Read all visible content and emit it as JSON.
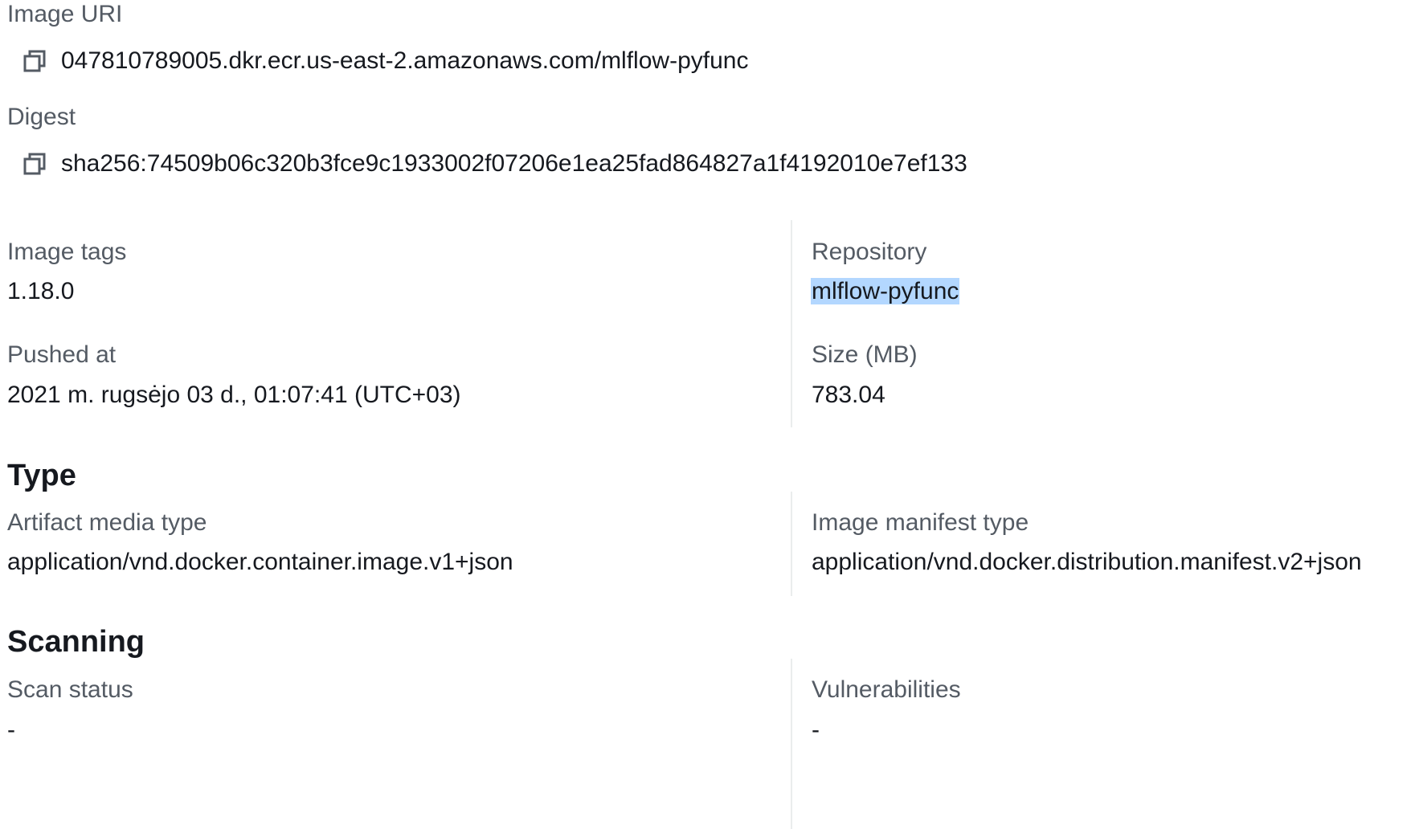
{
  "image_uri": {
    "label": "Image URI",
    "value": "047810789005.dkr.ecr.us-east-2.amazonaws.com/mlflow-pyfunc"
  },
  "digest": {
    "label": "Digest",
    "value": "sha256:74509b06c320b3fce9c1933002f07206e1ea25fad864827a1f4192010e7ef133"
  },
  "details": {
    "image_tags_label": "Image tags",
    "image_tags_value": "1.18.0",
    "repository_label": "Repository",
    "repository_value": "mlflow-pyfunc",
    "pushed_at_label": "Pushed at",
    "pushed_at_value": "2021 m. rugsėjo 03 d., 01:07:41 (UTC+03)",
    "size_label": "Size (MB)",
    "size_value": "783.04"
  },
  "type_section": {
    "heading": "Type",
    "artifact_media_type_label": "Artifact media type",
    "artifact_media_type_value": "application/vnd.docker.container.image.v1+json",
    "image_manifest_type_label": "Image manifest type",
    "image_manifest_type_value": "application/vnd.docker.distribution.manifest.v2+json"
  },
  "scanning_section": {
    "heading": "Scanning",
    "scan_status_label": "Scan status",
    "scan_status_value": "-",
    "vulnerabilities_label": "Vulnerabilities",
    "vulnerabilities_value": "-"
  },
  "icons": {
    "copy": "copy-icon"
  },
  "colors": {
    "label": "#545b64",
    "text": "#16191f",
    "selection_highlight": "#b3d7ff",
    "divider": "#eaeded"
  }
}
